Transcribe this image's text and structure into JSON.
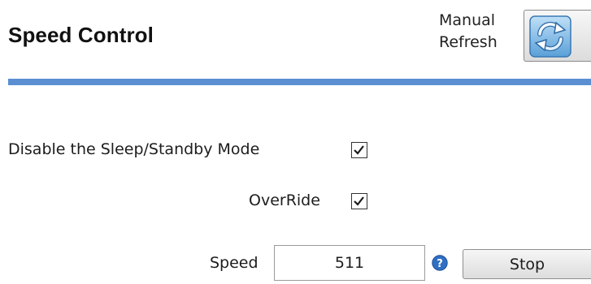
{
  "header": {
    "title": "Speed Control",
    "refresh_label_line1": "Manual",
    "refresh_label_line2": "Refresh",
    "refresh_icon": "refresh-icon",
    "divider_color": "#5b8fd1"
  },
  "settings": {
    "disable_sleep_label": "Disable the Sleep/Standby Mode",
    "disable_sleep_checked": true,
    "override_label": "OverRide",
    "override_checked": true,
    "speed_label": "Speed",
    "speed_value": "511",
    "help_icon": "help-icon",
    "stop_label": "Stop"
  }
}
